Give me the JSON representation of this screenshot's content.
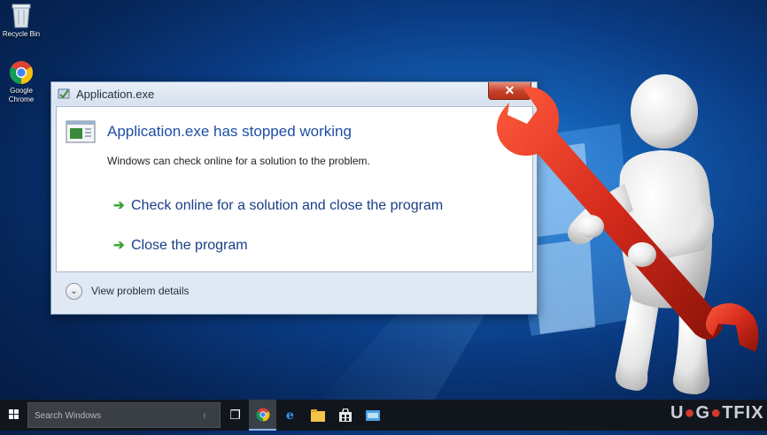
{
  "desktop": {
    "icons": [
      {
        "label": "Recycle Bin",
        "icon": "recycle-bin-icon"
      },
      {
        "label": "Google Chrome",
        "icon": "chrome-icon"
      }
    ]
  },
  "dialog": {
    "title": "Application.exe",
    "close_label": "✕",
    "heading": "Application.exe has stopped working",
    "description": "Windows can check online for a solution to the problem.",
    "commands": [
      {
        "label": "Check online for a solution and close the program",
        "icon": "green-arrow-icon"
      },
      {
        "label": "Close the program",
        "icon": "green-arrow-icon"
      }
    ],
    "details_label": "View problem details"
  },
  "taskbar": {
    "search_placeholder": "Search Windows",
    "apps": [
      "task-view-icon",
      "chrome-icon",
      "edge-icon",
      "file-explorer-icon",
      "store-icon",
      "app-icon"
    ]
  },
  "watermark": {
    "text_left": "U",
    "text_mid": "G",
    "text_right": "TFIX"
  },
  "colors": {
    "heading": "#1d4fa3",
    "command": "#1a3e86",
    "arrow": "#35a534",
    "close": "#c4412a",
    "wrench": "#d42a1c"
  }
}
